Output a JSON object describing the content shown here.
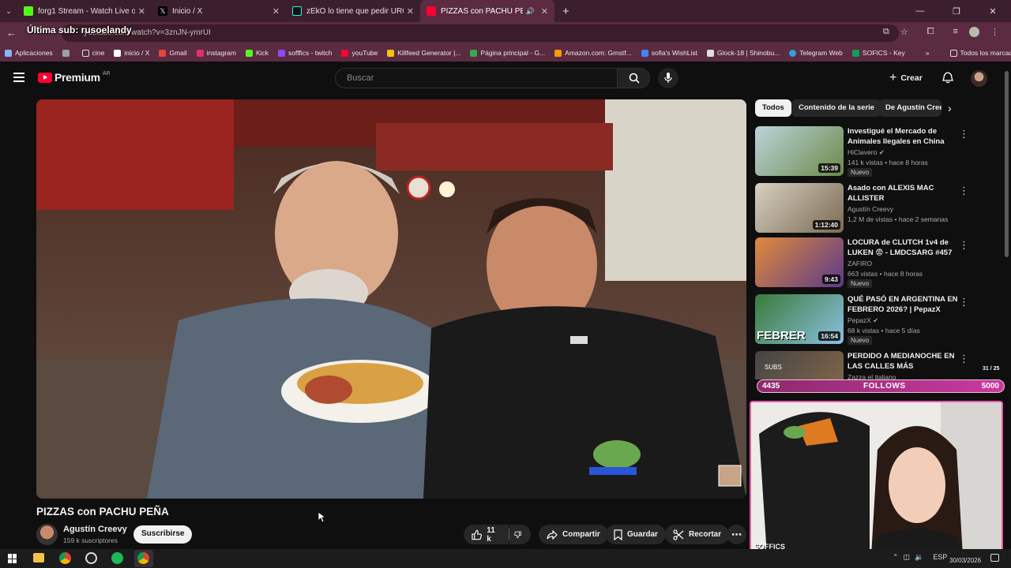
{
  "browser": {
    "tabs": [
      {
        "label": "forg1 Stream - Watch Live on K",
        "color": "#53fc18"
      },
      {
        "label": "Inicio / X",
        "color": "#222"
      },
      {
        "label": "zEkO lo tiene que pedir URGEN",
        "color": "#111"
      },
      {
        "label": "PIZZAS con PACHU PEÑA -",
        "color": "#ff0033",
        "active": true
      }
    ],
    "url": "youtube.com/watch?v=3znJN-ymrUI",
    "bookmarks": [
      {
        "label": "Aplicaciones",
        "color": "#8ab4f8"
      },
      {
        "label": "",
        "color": "#9aa0a6"
      },
      {
        "label": "cine",
        "color": "#bbb"
      },
      {
        "label": "inicio / X",
        "color": "#fff"
      },
      {
        "label": "Gmail",
        "color": "#ea4335"
      },
      {
        "label": "instagram",
        "color": "#e1306c"
      },
      {
        "label": "Kick",
        "color": "#53fc18"
      },
      {
        "label": "sofffics - twitch",
        "color": "#9146ff"
      },
      {
        "label": "youTube",
        "color": "#ff0033"
      },
      {
        "label": "Killfeed Generator |...",
        "color": "#f4c20d"
      },
      {
        "label": "Página principal - G...",
        "color": "#34a853"
      },
      {
        "label": "Amazon.com: Grnstf...",
        "color": "#ff9900"
      },
      {
        "label": "sofia's WishList",
        "color": "#4285f4"
      },
      {
        "label": "Glock-18 | Shinobu...",
        "color": "#ddd"
      },
      {
        "label": "Telegram Web",
        "color": "#2aa3de"
      },
      {
        "label": "SOFICS - Key",
        "color": "#0f9d58"
      }
    ],
    "bookmarks_all": "Todos los marcadores"
  },
  "stream_overlay": {
    "last_sub": "Última sub: rusoelandy",
    "follows_current": "4435",
    "follows_label": "FOLLOWS",
    "follows_goal": "5000",
    "subs_label": "SUBS",
    "subs_count": "31 / 25",
    "cam_label": "SOFFICS"
  },
  "youtube": {
    "logo": "Premium",
    "region": "AR",
    "search_placeholder": "Buscar",
    "create_label": "Crear",
    "chips": [
      "Todos",
      "Contenido de la serie",
      "De Agustín Cree"
    ],
    "video": {
      "title": "PIZZAS con PACHU PEÑA",
      "channel": "Agustín Creevy",
      "subscribers": "159 k suscriptores",
      "subscribe_label": "Suscribirse",
      "likes": "11 k",
      "share_label": "Compartir",
      "save_label": "Guardar",
      "clip_label": "Recortar"
    },
    "recommendations": [
      {
        "title": "Investigué el Mercado de Animales Ilegales en China",
        "channel": "HiClavero",
        "meta": "141 k vistas • hace 8 horas",
        "duration": "15:39",
        "badge": "Nuevo"
      },
      {
        "title": "Asado con ALEXIS MAC ALLISTER",
        "channel": "Agustín Creevy",
        "meta": "1,2 M de vistas • hace 2 semanas",
        "duration": "1:12:40",
        "badge": ""
      },
      {
        "title": "LOCURA de CLUTCH 1v4 de LUKEN 😨 - LMDCSARG #457 ...",
        "channel": "ZAFIRO",
        "meta": "663 vistas • hace 8 horas",
        "duration": "9:43",
        "badge": "Nuevo"
      },
      {
        "title": "QUÉ PASÓ EN ARGENTINA EN FEBRERO 2026? | PepazX",
        "channel": "PepazX",
        "meta": "68 k vistas • hace 5 días",
        "duration": "16:54",
        "badge": "Nuevo"
      },
      {
        "title": "PERDIDO A MEDIANOCHE EN LAS CALLES MÁS PELIGROSA...",
        "channel": "Zazza el italiano",
        "meta": "",
        "duration": "",
        "badge": ""
      }
    ]
  },
  "taskbar": {
    "lang": "ESP",
    "date": "30/03/2026"
  }
}
